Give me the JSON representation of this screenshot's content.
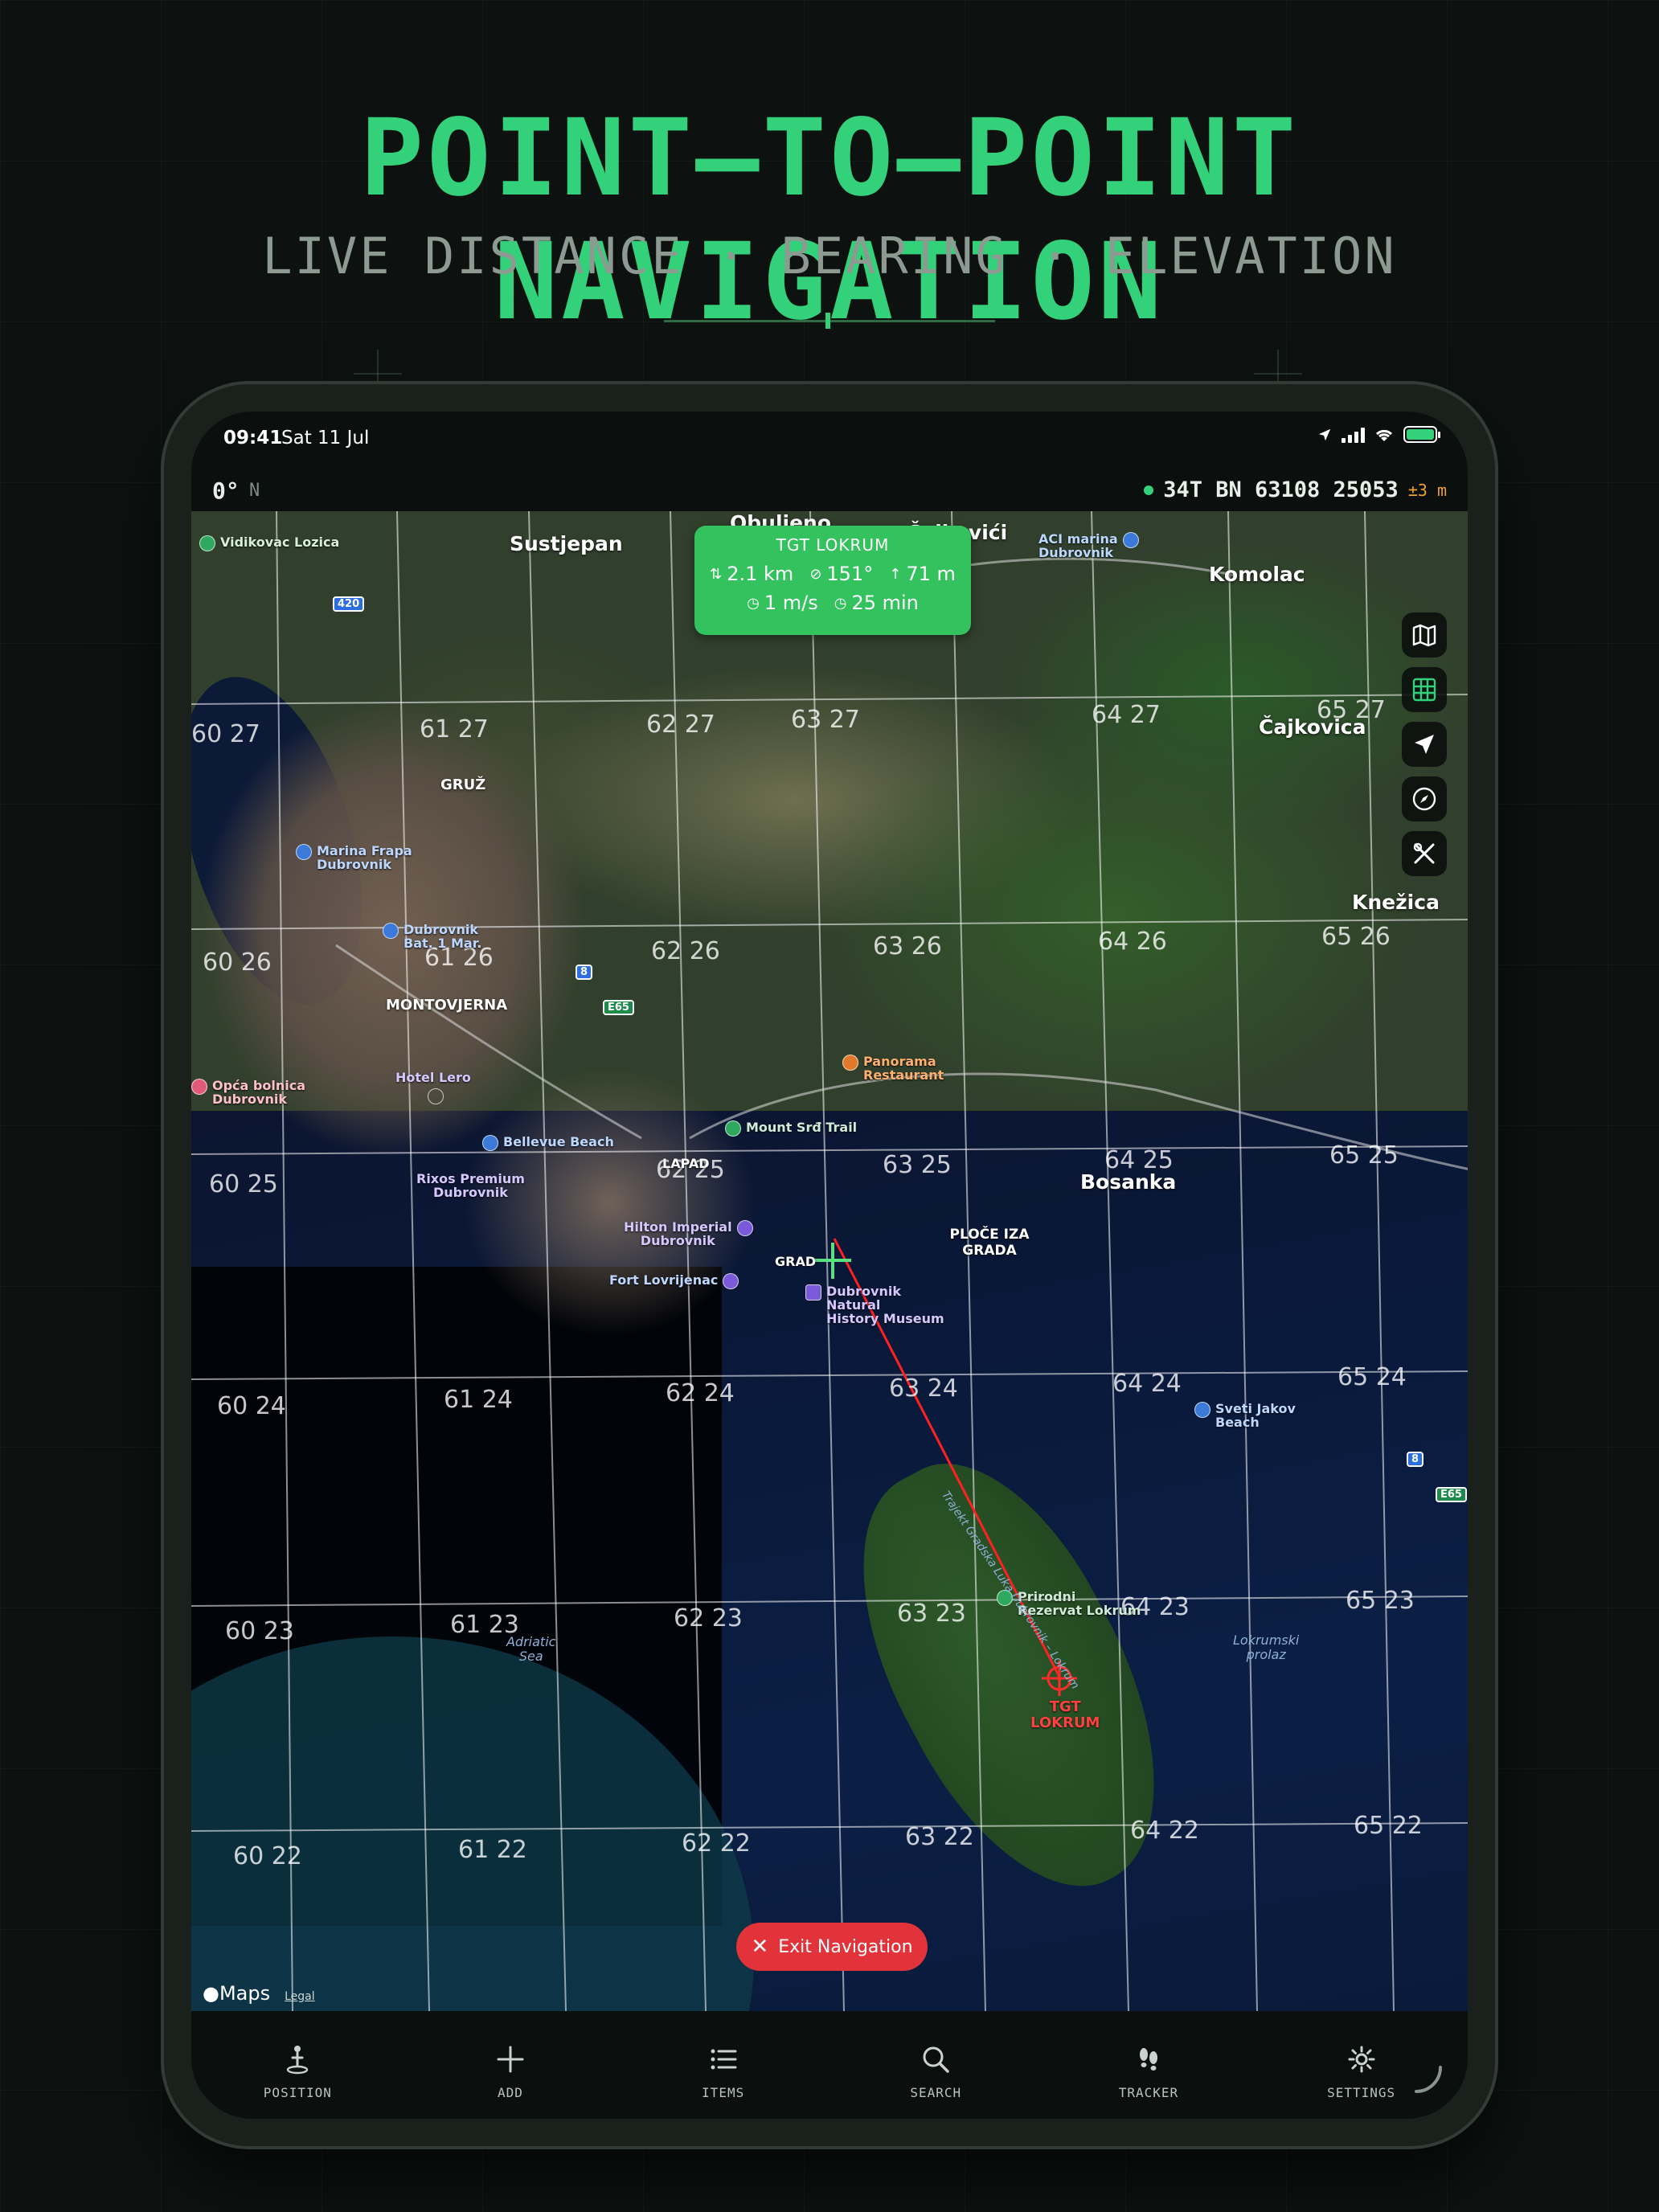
{
  "hero": {
    "title": "POINT–TO–POINT NAVIGATION",
    "subtitle": "LIVE DISTANCE · BEARING · ELEVATION"
  },
  "status_bar": {
    "time": "09:41",
    "date": "Sat 11 Jul"
  },
  "info_bar": {
    "heading": "0°",
    "heading_ref": "N",
    "grid_ref": "34T BN 63108 25053",
    "accuracy": "±3 m"
  },
  "nav_card": {
    "title": "TGT LOKRUM",
    "distance": "2.1 km",
    "bearing": "151°",
    "elevation": "71 m",
    "speed": "1 m/s",
    "eta": "25 min"
  },
  "map": {
    "grid_labels": [
      "62 27",
      "63 27",
      "64 27",
      "65 27",
      "60 27",
      "61 27",
      "62 26",
      "63 26",
      "64 26",
      "65 26",
      "60 26",
      "61 26",
      "62 25",
      "63 25",
      "64 25",
      "65 25",
      "60 25",
      "60 24",
      "61 24",
      "62 24",
      "63 24",
      "64 24",
      "65 24",
      "60 23",
      "61 23",
      "62 23",
      "63 23",
      "64 23",
      "65 23",
      "60 22",
      "61 22",
      "62 22",
      "63 22",
      "64 22",
      "65 22"
    ],
    "places": [
      "Sustjepan",
      "Obuljeno",
      "Čajkovići",
      "Komolac",
      "Čajkovica",
      "Knežica",
      "GRUŽ",
      "MONTOVJERNA",
      "Bosanka",
      "PLOČE IZA GRADA",
      "GRAD",
      "LAPAD"
    ],
    "pois": {
      "vidikovac": "Vidikovac Lozica",
      "aci_marina": "ACI marina\nDubrovnik",
      "marina_frapa": "Marina Frapa\nDubrovnik",
      "dubrovnik_bay": "Dubrovnik\nBat. 1 Mar.",
      "hotel_lero": "Hotel Lero",
      "opca_bolnica": "Opća bolnica\nDubrovnik",
      "bellevue": "Bellevue Beach",
      "rixos": "Rixos Premium\nDubrovnik",
      "hilton": "Hilton Imperial\nDubrovnik",
      "fort": "Fort Lovrijenac",
      "museum": "Dubrovnik\nNatural\nHistory Museum",
      "panorama": "Panorama\nRestaurant",
      "mount_srd": "Mount Srđ Trail",
      "sveti_jakov": "Sveti Jakov\nBeach",
      "prirodni": "Prirodni\nRezervat Lokrum",
      "target": "TGT\nLOKRUM"
    },
    "water_labels": {
      "adriatic": "Adriatic\nSea",
      "lokrumski": "Lokrumski\nprolaz",
      "channel": "Trajekt Gradska Luka Dubrovnik – Lokrum"
    },
    "road_shields": [
      "420",
      "8",
      "E65",
      "8",
      "E65"
    ],
    "exit_label": "Exit Navigation",
    "credit": "Maps",
    "legal": "Legal"
  },
  "tabs": [
    {
      "label": "POSITION"
    },
    {
      "label": "ADD"
    },
    {
      "label": "ITEMS"
    },
    {
      "label": "SEARCH"
    },
    {
      "label": "TRACKER"
    },
    {
      "label": "SETTINGS"
    }
  ],
  "colors": {
    "accent": "#33d17a",
    "nav_card": "#33c25e",
    "exit": "#e2333b",
    "route": "#ff2020"
  }
}
